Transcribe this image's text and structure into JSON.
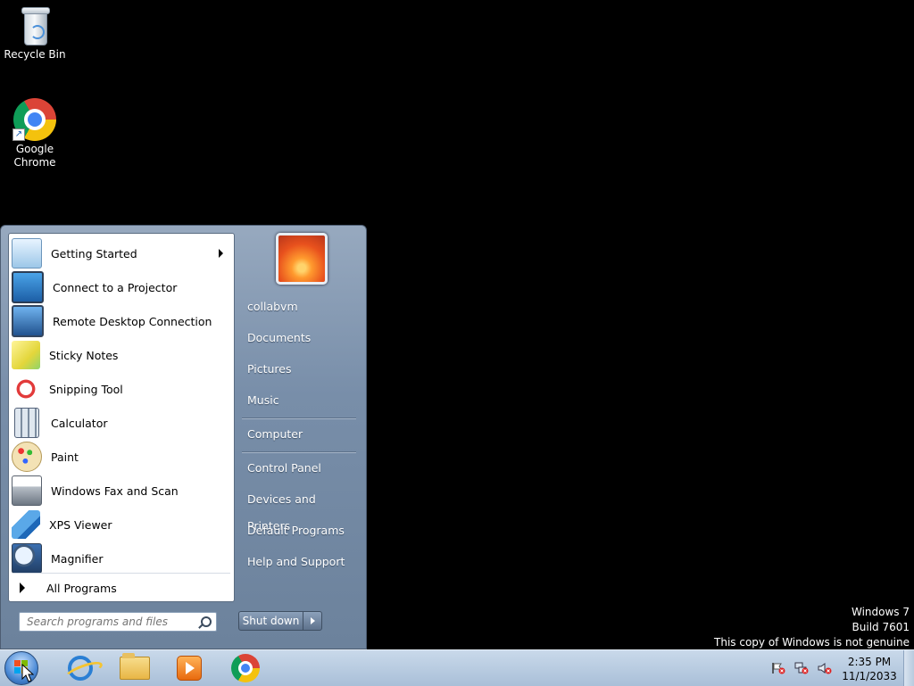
{
  "desktop": {
    "icons": [
      {
        "label": "Recycle Bin",
        "icon": "recycle-bin-icon"
      },
      {
        "label": "Google Chrome",
        "icon": "chrome-icon"
      }
    ]
  },
  "start_menu": {
    "programs": [
      {
        "label": "Getting Started",
        "icon": "getting-started-icon",
        "has_submenu": true
      },
      {
        "label": "Connect to a Projector",
        "icon": "projector-icon"
      },
      {
        "label": "Remote Desktop Connection",
        "icon": "remote-desktop-icon"
      },
      {
        "label": "Sticky Notes",
        "icon": "sticky-notes-icon"
      },
      {
        "label": "Snipping Tool",
        "icon": "snipping-tool-icon"
      },
      {
        "label": "Calculator",
        "icon": "calculator-icon"
      },
      {
        "label": "Paint",
        "icon": "paint-icon"
      },
      {
        "label": "Windows Fax and Scan",
        "icon": "fax-scan-icon"
      },
      {
        "label": "XPS Viewer",
        "icon": "xps-viewer-icon"
      },
      {
        "label": "Magnifier",
        "icon": "magnifier-icon"
      }
    ],
    "all_programs_label": "All Programs",
    "search_placeholder": "Search programs and files",
    "right_links": [
      {
        "label": "collabvm"
      },
      {
        "label": "Documents"
      },
      {
        "label": "Pictures"
      },
      {
        "label": "Music"
      },
      {
        "label": "Computer"
      },
      {
        "label": "Control Panel"
      },
      {
        "label": "Devices and Printers"
      },
      {
        "label": "Default Programs"
      },
      {
        "label": "Help and Support"
      }
    ],
    "shutdown_label": "Shut down"
  },
  "watermark": {
    "line1": "Windows 7",
    "line2": "Build 7601",
    "line3": "This copy of Windows is not genuine"
  },
  "taskbar": {
    "pinned": [
      "internet-explorer-icon",
      "windows-explorer-icon",
      "media-player-icon",
      "chrome-icon"
    ],
    "tray_icons": [
      "action-center-flag-icon",
      "network-icon",
      "volume-muted-icon"
    ],
    "clock_time": "2:35 PM",
    "clock_date": "11/1/2033"
  },
  "colors": {
    "desktop_background": "#000000",
    "start_menu_right_pane": "#788ea9",
    "taskbar": "#b9cde2"
  }
}
